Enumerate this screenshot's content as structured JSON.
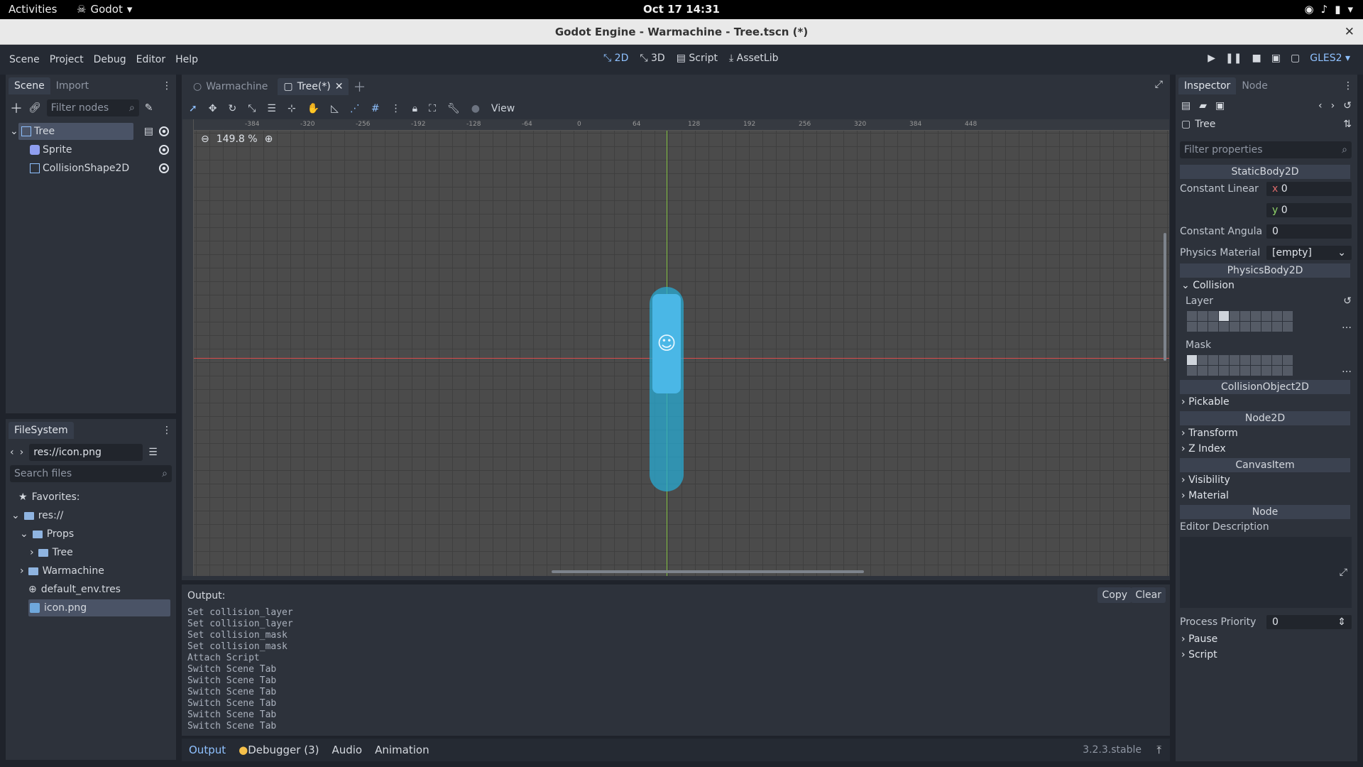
{
  "topbar": {
    "activities": "Activities",
    "app": "Godot",
    "clock": "Oct 17  14:31"
  },
  "window": {
    "title": "Godot Engine - Warmachine - Tree.tscn (*)"
  },
  "menu": {
    "items": [
      "Scene",
      "Project",
      "Debug",
      "Editor",
      "Help"
    ],
    "workspaces": [
      "2D",
      "3D",
      "Script",
      "AssetLib"
    ],
    "renderer": "GLES2"
  },
  "scene_dock": {
    "tabs": [
      "Scene",
      "Import"
    ],
    "filter_placeholder": "Filter nodes",
    "nodes": [
      "Tree",
      "Sprite",
      "CollisionShape2D"
    ]
  },
  "filesystem": {
    "title": "FileSystem",
    "path": "res://icon.png",
    "search_placeholder": "Search files",
    "items": [
      "Favorites:",
      "res://",
      "Props",
      "Tree",
      "Warmachine",
      "default_env.tres",
      "icon.png"
    ]
  },
  "scene_tabs": [
    "Warmachine",
    "Tree(*)"
  ],
  "viewport": {
    "zoom": "149.8 %",
    "view_menu": "View",
    "ruler_ticks": [
      "-384",
      "-320",
      "-256",
      "-192",
      "-128",
      "-64",
      "0",
      "64",
      "128",
      "192",
      "256",
      "320",
      "384",
      "448"
    ]
  },
  "output": {
    "label": "Output:",
    "copy": "Copy",
    "clear": "Clear",
    "lines": [
      "Set collision_layer",
      "Set collision_layer",
      "Set collision_mask",
      "Set collision_mask",
      "Attach Script",
      "Switch Scene Tab",
      "Switch Scene Tab",
      "Switch Scene Tab",
      "Switch Scene Tab",
      "Switch Scene Tab",
      "Switch Scene Tab"
    ]
  },
  "bottom_tabs": [
    "Output",
    "Debugger (3)",
    "Audio",
    "Animation"
  ],
  "version": "3.2.3.stable",
  "inspector": {
    "tabs": [
      "Inspector",
      "Node"
    ],
    "node_name": "Tree",
    "filter_placeholder": "Filter properties",
    "sections": {
      "static_body": "StaticBody2D",
      "physics_body": "PhysicsBody2D",
      "collision_object": "CollisionObject2D",
      "node2d": "Node2D",
      "canvas_item": "CanvasItem",
      "node": "Node"
    },
    "props": {
      "constant_linear": "Constant Linear",
      "cl_x_label": "x",
      "cl_x": "0",
      "cl_y_label": "y",
      "cl_y": "0",
      "constant_angular": "Constant Angula",
      "ca_val": "0",
      "physics_material": "Physics Material",
      "pm_val": "[empty]",
      "collision": "Collision",
      "layer": "Layer",
      "mask": "Mask",
      "pickable": "Pickable",
      "transform": "Transform",
      "z_index": "Z Index",
      "visibility": "Visibility",
      "material": "Material",
      "editor_description": "Editor Description",
      "process_priority": "Process Priority",
      "pp_val": "0",
      "pause": "Pause",
      "script": "Script"
    }
  }
}
